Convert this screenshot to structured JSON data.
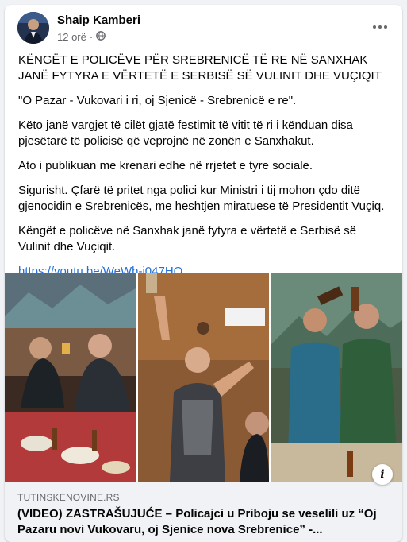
{
  "post": {
    "author": "Shaip Kamberi",
    "time": "12 orë",
    "privacy_separator": "·",
    "privacy_icon": "globe-icon",
    "more_icon": "more-horizontal-icon",
    "paragraphs": [
      "KËNGËT E POLICËVE PËR SREBRENICË TË RE NË SANXHAK JANË FYTYRA E VËRTETË E SERBISË SË VULINIT DHE VUÇIQIT",
      "\"O Pazar - Vukovari i ri, oj Sjenicë - Srebrenicë e re\".",
      "Këto janë vargjet të cilët gjatë festimit të vitit të ri i kënduan disa pjesëtarë të policisë që veprojnë në zonën e Sanxhakut.",
      "Ato i publikuan me krenari edhe në rrjetet e tyre sociale.",
      "Sigurisht. Çfarë të pritet nga polici kur Ministri i tij mohon çdo ditë gjenocidin e Srebrenicës, me heshtjen miratuese të Presidentit Vuçiq.",
      "Këngët e policëve në Sanxhak janë fytyra e vërtetë e Serbisë së Vulinit dhe Vuçiqit."
    ],
    "link": "https://youtu.be/WeWh-i047HQ"
  },
  "preview": {
    "domain": "TUTINSKENOVINE.RS",
    "title": "(VIDEO) ZASTRAŠUJUĆE – Policajci u Priboju se veselili uz “Oj Pazaru novi Vukovaru, oj Sjenice nova Srebrenice” -...",
    "info_icon": "info-icon",
    "info_glyph": "i"
  },
  "colors": {
    "link": "#216fdb",
    "secondary_text": "#65676b",
    "preview_bg": "#f0f2f5"
  }
}
